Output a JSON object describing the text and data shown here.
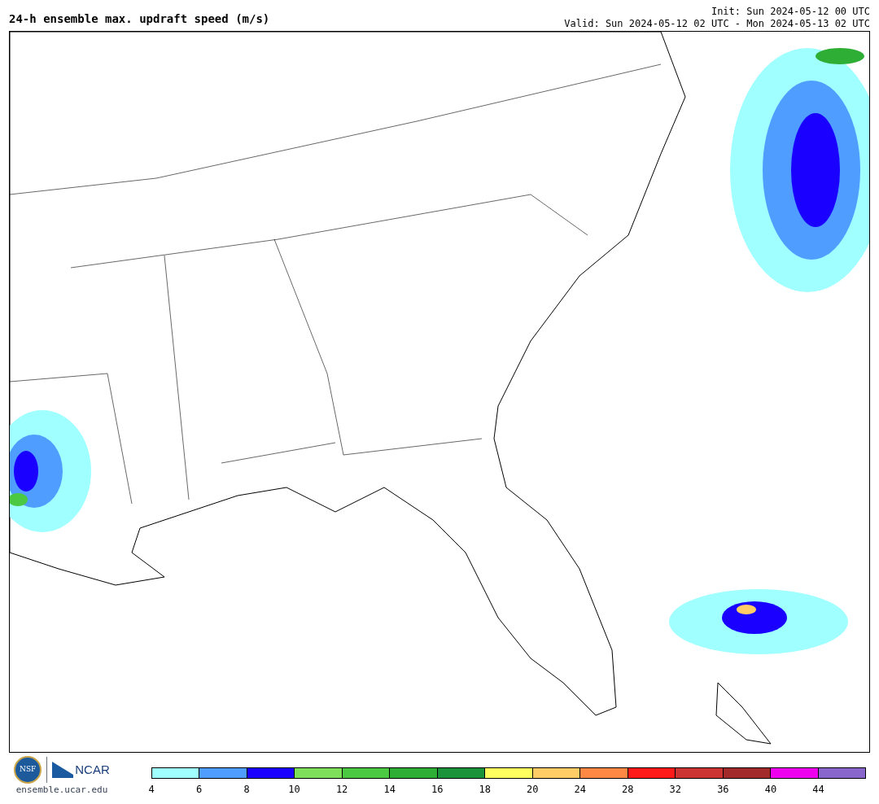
{
  "title": "24-h ensemble max. updraft speed (m/s)",
  "init": "Init: Sun 2024-05-12 00 UTC",
  "valid": "Valid: Sun 2024-05-12 02 UTC - Mon 2024-05-13 02 UTC",
  "logos": {
    "nsf": "NSF",
    "ncar": "NCAR",
    "site": "ensemble.ucar.edu"
  },
  "colorbar": [
    {
      "label": "4",
      "color": "#a0ffff"
    },
    {
      "label": "6",
      "color": "#4f9dff"
    },
    {
      "label": "8",
      "color": "#1a00ff"
    },
    {
      "label": "10",
      "color": "#7ee05a"
    },
    {
      "label": "12",
      "color": "#4cc943"
    },
    {
      "label": "14",
      "color": "#2fae35"
    },
    {
      "label": "16",
      "color": "#1b933a"
    },
    {
      "label": "18",
      "color": "#ffff60"
    },
    {
      "label": "20",
      "color": "#ffcc66"
    },
    {
      "label": "24",
      "color": "#ff8844"
    },
    {
      "label": "28",
      "color": "#ff1a1a"
    },
    {
      "label": "32",
      "color": "#cc3333"
    },
    {
      "label": "36",
      "color": "#a32a2a"
    },
    {
      "label": "40",
      "color": "#ee00ee"
    },
    {
      "label": "44",
      "color": "#8866cc"
    }
  ]
}
